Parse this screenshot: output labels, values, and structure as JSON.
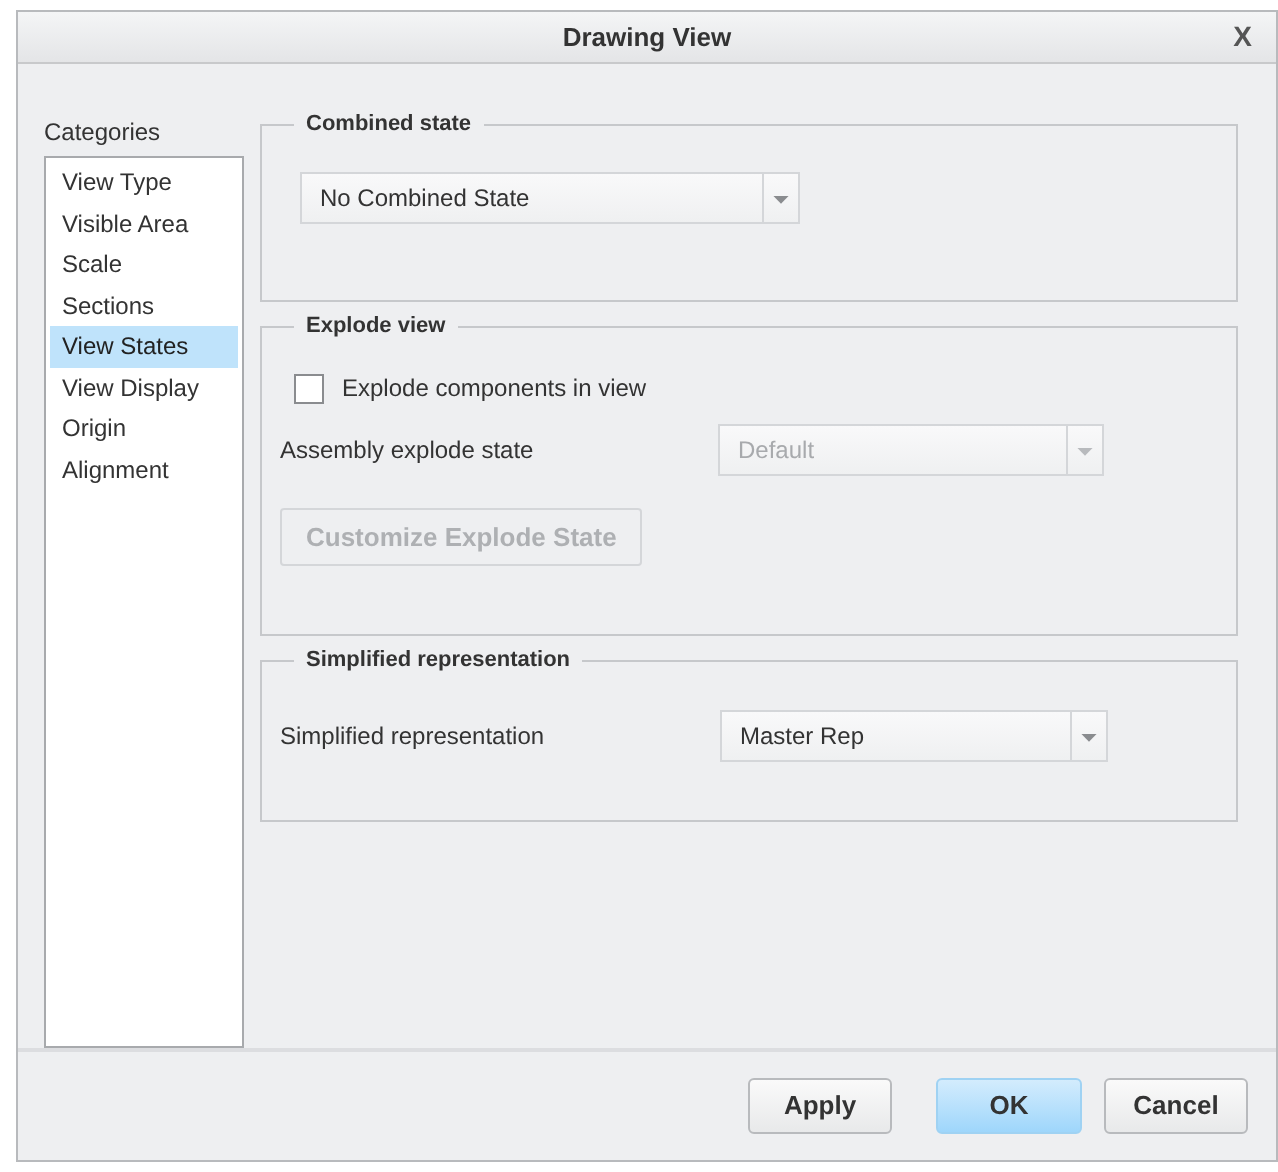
{
  "window": {
    "title": "Drawing View",
    "close": "X"
  },
  "categories": {
    "label": "Categories",
    "items": [
      {
        "label": "View Type",
        "selected": false
      },
      {
        "label": "Visible Area",
        "selected": false
      },
      {
        "label": "Scale",
        "selected": false
      },
      {
        "label": "Sections",
        "selected": false
      },
      {
        "label": "View States",
        "selected": true
      },
      {
        "label": "View Display",
        "selected": false
      },
      {
        "label": "Origin",
        "selected": false
      },
      {
        "label": "Alignment",
        "selected": false
      }
    ]
  },
  "combined_state": {
    "title": "Combined state",
    "dropdown": {
      "value": "No Combined State",
      "disabled": false
    }
  },
  "explode_view": {
    "title": "Explode view",
    "checkbox": {
      "label": "Explode components in view",
      "checked": false
    },
    "assembly_label": "Assembly explode state",
    "dropdown": {
      "value": "Default",
      "disabled": true
    },
    "button": {
      "label": "Customize Explode State",
      "disabled": true
    }
  },
  "simplified_representation": {
    "title": "Simplified representation",
    "label": "Simplified representation",
    "dropdown": {
      "value": "Master Rep",
      "disabled": false
    }
  },
  "buttons": [
    {
      "label": "Apply",
      "kind": "normal"
    },
    {
      "label": "OK",
      "kind": "primary"
    },
    {
      "label": "Cancel",
      "kind": "normal"
    }
  ]
}
